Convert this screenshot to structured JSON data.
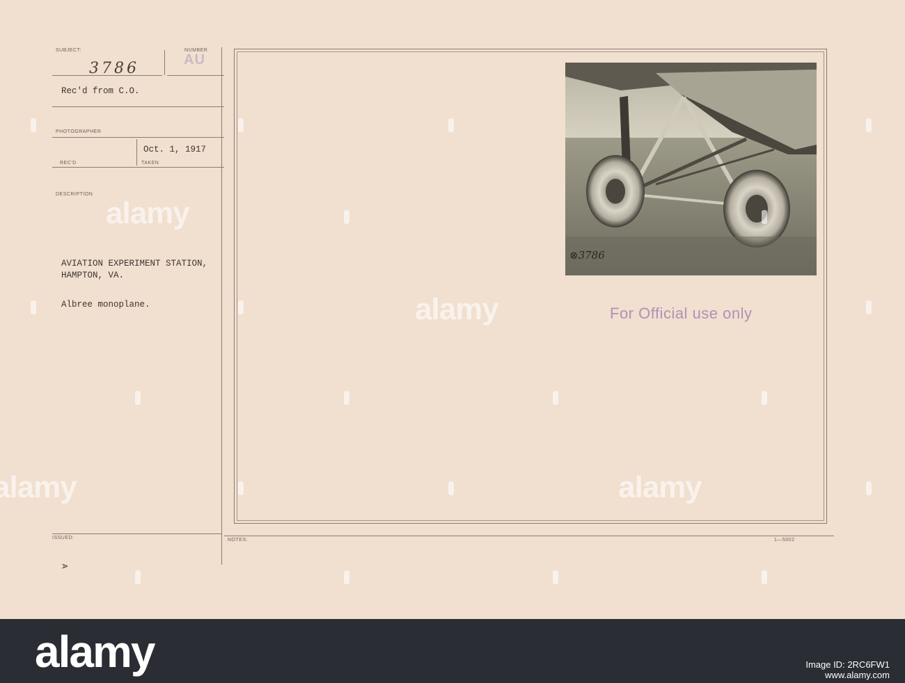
{
  "record_card": {
    "subject_label": "SUBJECT:",
    "subject_value": "3786",
    "number_label": "NUMBER",
    "number_value": "AU",
    "received_from": "Rec'd from C.O.",
    "photographer_label": "PHOTOGRAPHER",
    "date_taken": "Oct. 1, 1917",
    "recd_label": "REC'D",
    "taken_label": "TAKEN",
    "description_label": "DESCRIPTION",
    "description_line1": "AVIATION EXPERIMENT STATION,",
    "description_line2": "HAMPTON, VA.",
    "description_line3": "Albree monoplane.",
    "issued_label": "ISSUED:",
    "notes_label": "NOTES:",
    "form_code": "1—5002",
    "corner_mark": "A"
  },
  "photo": {
    "subject": "aircraft landing gear wheels on grass",
    "negative_number": "⊗3786",
    "bg_color": "#8f8a7a"
  },
  "stamp": {
    "text": "For Official use only",
    "color": "#b48fb6"
  },
  "watermark": {
    "text": "alamy"
  },
  "footer": {
    "logo": "alamy",
    "image_id_label": "Image ID:",
    "image_id": "2RC6FW1",
    "site": "www.alamy.com"
  }
}
